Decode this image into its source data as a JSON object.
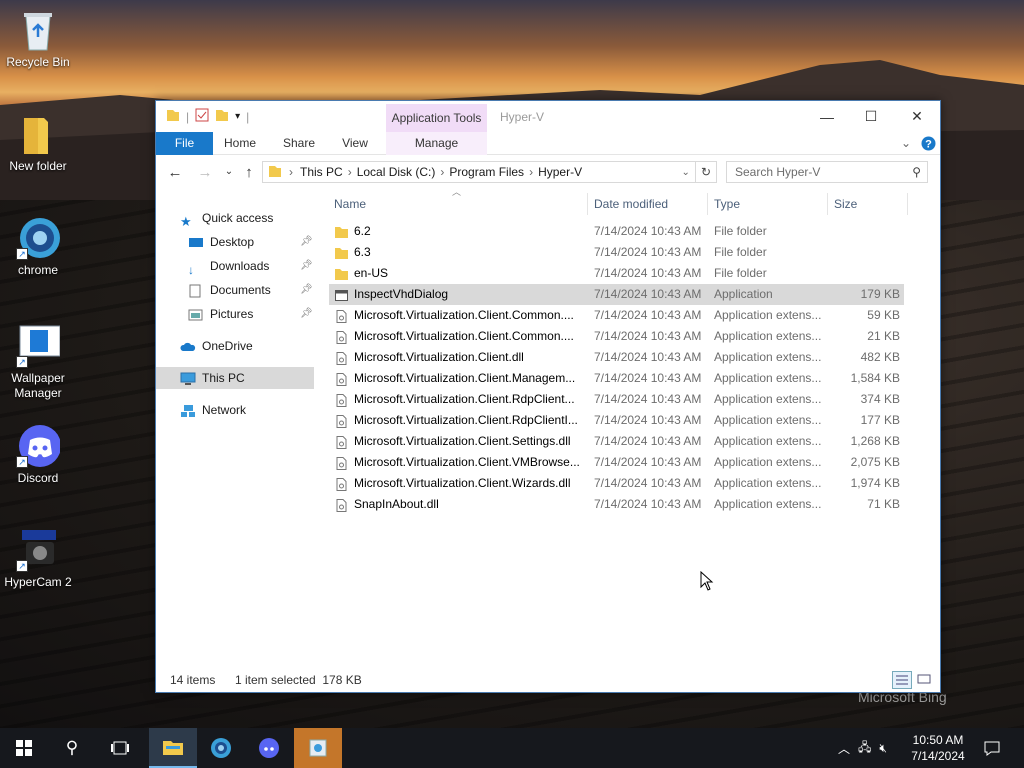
{
  "desktop": {
    "icons": [
      {
        "label": "Recycle Bin"
      },
      {
        "label": "New folder"
      },
      {
        "label": "chrome"
      },
      {
        "label": "Wallpaper Manager"
      },
      {
        "label": "Discord"
      },
      {
        "label": "HyperCam 2"
      }
    ],
    "watermark": "Microsoft Bing"
  },
  "window": {
    "title": "Hyper-V",
    "context_tab": "Application Tools",
    "ribbon_tabs": [
      "File",
      "Home",
      "Share",
      "View",
      "Manage"
    ],
    "breadcrumb": [
      "This PC",
      "Local Disk (C:)",
      "Program Files",
      "Hyper-V"
    ],
    "search_placeholder": "Search Hyper-V",
    "nav": [
      {
        "label": "Quick access",
        "icon": "star-icon"
      },
      {
        "label": "Desktop",
        "icon": "desktop-icon",
        "pinned": true
      },
      {
        "label": "Downloads",
        "icon": "download-icon",
        "pinned": true
      },
      {
        "label": "Documents",
        "icon": "document-icon",
        "pinned": true
      },
      {
        "label": "Pictures",
        "icon": "picture-icon",
        "pinned": true
      },
      {
        "label": "OneDrive",
        "icon": "cloud-icon"
      },
      {
        "label": "This PC",
        "icon": "computer-icon",
        "selected": true
      },
      {
        "label": "Network",
        "icon": "network-icon"
      }
    ],
    "columns": [
      "Name",
      "Date modified",
      "Type",
      "Size"
    ],
    "files": [
      {
        "name": "6.2",
        "date": "7/14/2024 10:43 AM",
        "type": "File folder",
        "size": "",
        "kind": "folder"
      },
      {
        "name": "6.3",
        "date": "7/14/2024 10:43 AM",
        "type": "File folder",
        "size": "",
        "kind": "folder"
      },
      {
        "name": "en-US",
        "date": "7/14/2024 10:43 AM",
        "type": "File folder",
        "size": "",
        "kind": "folder"
      },
      {
        "name": "InspectVhdDialog",
        "date": "7/14/2024 10:43 AM",
        "type": "Application",
        "size": "179 KB",
        "kind": "app",
        "selected": true
      },
      {
        "name": "Microsoft.Virtualization.Client.Common....",
        "date": "7/14/2024 10:43 AM",
        "type": "Application extens...",
        "size": "59 KB",
        "kind": "dll"
      },
      {
        "name": "Microsoft.Virtualization.Client.Common....",
        "date": "7/14/2024 10:43 AM",
        "type": "Application extens...",
        "size": "21 KB",
        "kind": "dll"
      },
      {
        "name": "Microsoft.Virtualization.Client.dll",
        "date": "7/14/2024 10:43 AM",
        "type": "Application extens...",
        "size": "482 KB",
        "kind": "dll"
      },
      {
        "name": "Microsoft.Virtualization.Client.Managem...",
        "date": "7/14/2024 10:43 AM",
        "type": "Application extens...",
        "size": "1,584 KB",
        "kind": "dll"
      },
      {
        "name": "Microsoft.Virtualization.Client.RdpClient...",
        "date": "7/14/2024 10:43 AM",
        "type": "Application extens...",
        "size": "374 KB",
        "kind": "dll"
      },
      {
        "name": "Microsoft.Virtualization.Client.RdpClientI...",
        "date": "7/14/2024 10:43 AM",
        "type": "Application extens...",
        "size": "177 KB",
        "kind": "dll"
      },
      {
        "name": "Microsoft.Virtualization.Client.Settings.dll",
        "date": "7/14/2024 10:43 AM",
        "type": "Application extens...",
        "size": "1,268 KB",
        "kind": "dll"
      },
      {
        "name": "Microsoft.Virtualization.Client.VMBrowse...",
        "date": "7/14/2024 10:43 AM",
        "type": "Application extens...",
        "size": "2,075 KB",
        "kind": "dll"
      },
      {
        "name": "Microsoft.Virtualization.Client.Wizards.dll",
        "date": "7/14/2024 10:43 AM",
        "type": "Application extens...",
        "size": "1,974 KB",
        "kind": "dll"
      },
      {
        "name": "SnapInAbout.dll",
        "date": "7/14/2024 10:43 AM",
        "type": "Application extens...",
        "size": "71 KB",
        "kind": "dll"
      }
    ],
    "status": {
      "count": "14 items",
      "selection": "1 item selected  178 KB"
    }
  },
  "taskbar": {
    "time": "10:50 AM",
    "date": "7/14/2024"
  },
  "colors": {
    "accent": "#1979ca",
    "selection": "#d9d9d9",
    "context_tab": "#f1dcf7",
    "taskbar": "#16181d"
  }
}
